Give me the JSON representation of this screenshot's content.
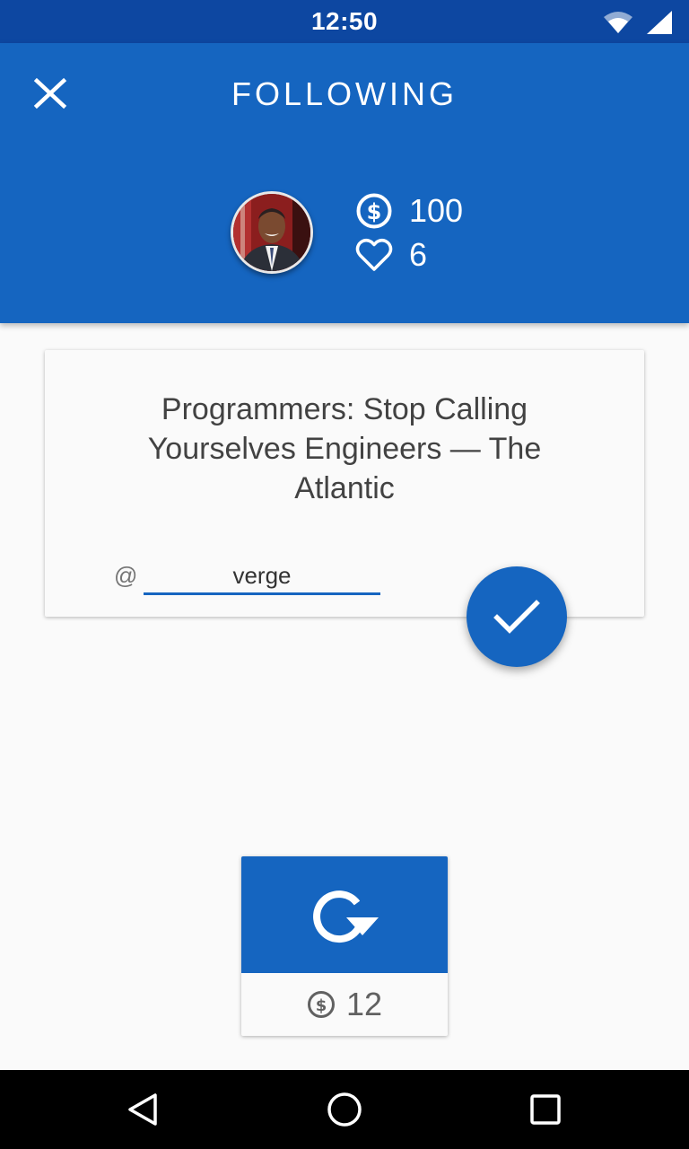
{
  "status_bar": {
    "time": "12:50",
    "icons": [
      "wifi-icon",
      "cell-signal-icon"
    ]
  },
  "header": {
    "title": "FOLLOWING",
    "close_icon": "close-icon",
    "coins": "100",
    "likes": "6"
  },
  "card": {
    "title": "Programmers: Stop Calling Yourselves Engineers — The Atlantic",
    "at_prefix": "@",
    "handle_value": "verge"
  },
  "fab": {
    "icon": "check-icon"
  },
  "refresh": {
    "icon": "refresh-icon",
    "cost": "12"
  },
  "nav": {
    "icons": [
      "back-icon",
      "home-icon",
      "recents-icon"
    ]
  },
  "colors": {
    "primary": "#1565c0",
    "status_bar": "#0d47a1",
    "text": "#424242"
  }
}
